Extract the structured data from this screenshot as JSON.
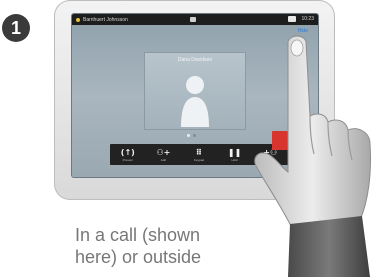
{
  "step": {
    "number": "1"
  },
  "device": {
    "status_bar": {
      "user_name": "Barnhuert Johnsson",
      "time": "10:23"
    },
    "top_link": "Hide",
    "call": {
      "participant_name": "Dana Davidsen"
    },
    "page_indicator": {
      "pages": 2,
      "active": 1
    },
    "toolbar": [
      {
        "glyph": "(↑)",
        "label": "Present"
      },
      {
        "glyph": "⚇+",
        "label": "Add"
      },
      {
        "glyph": "⠿",
        "label": "Keypad"
      },
      {
        "glyph": "❚❚",
        "label": "Hold"
      },
      {
        "glyph": "+⚇",
        "label": "Transfer"
      }
    ],
    "colors": {
      "end_call": "#d7352e",
      "link": "#2d7ad6",
      "status_dot": "#e3c23a"
    }
  },
  "caption": {
    "line1": "In a call (shown",
    "line2": "here) or outside"
  }
}
